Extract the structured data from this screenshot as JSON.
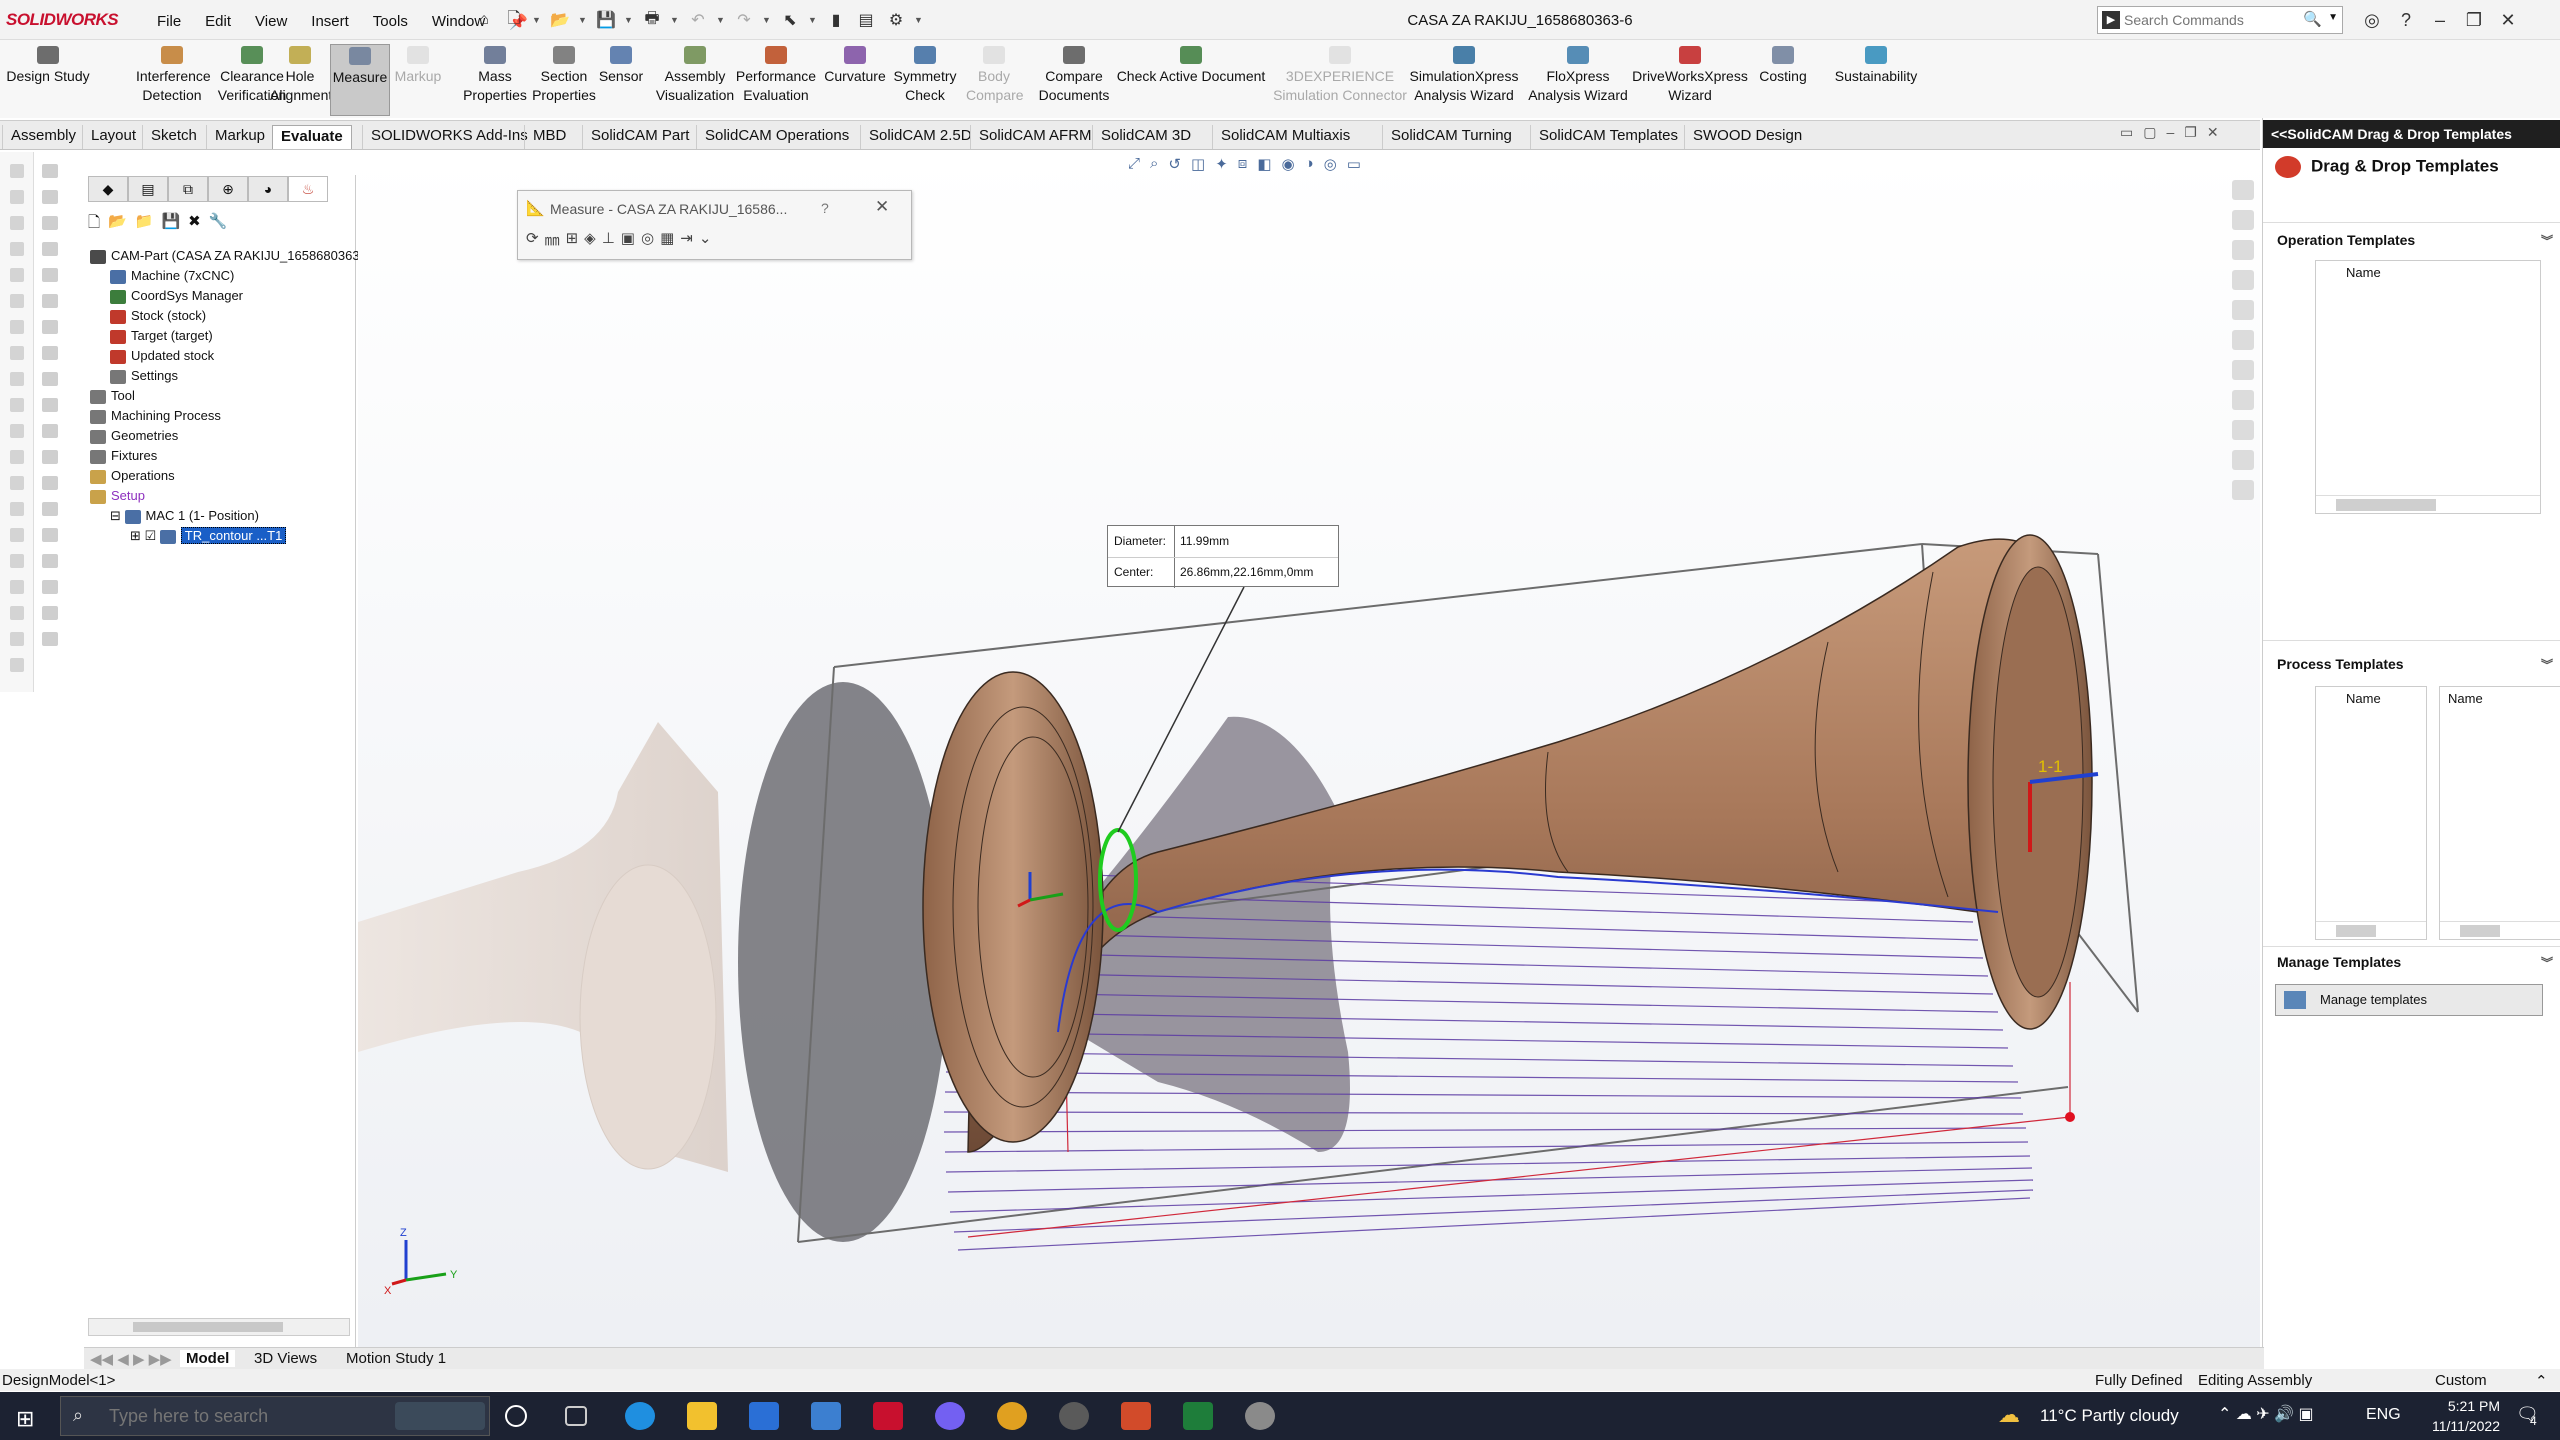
{
  "app": {
    "logo": "SOLIDWORKS",
    "document_title": "CASA ZA RAKIJU_1658680363-6"
  },
  "menus": [
    "File",
    "Edit",
    "View",
    "Insert",
    "Tools",
    "Window"
  ],
  "search": {
    "placeholder": "Search Commands"
  },
  "commands": [
    {
      "label1": "Design Study",
      "label2": "",
      "icon": "design-study-icon",
      "state": "normal"
    },
    {
      "label1": "Interference",
      "label2": "Detection",
      "icon": "interference-icon",
      "state": "normal"
    },
    {
      "label1": "Clearance",
      "label2": "Verification",
      "icon": "clearance-icon",
      "state": "normal"
    },
    {
      "label1": "Hole",
      "label2": "Alignment",
      "icon": "hole-icon",
      "state": "normal"
    },
    {
      "label1": "Measure",
      "label2": "",
      "icon": "measure-icon",
      "state": "active"
    },
    {
      "label1": "Markup",
      "label2": "",
      "icon": "markup-icon",
      "state": "disabled"
    },
    {
      "label1": "Mass",
      "label2": "Properties",
      "icon": "mass-icon",
      "state": "normal"
    },
    {
      "label1": "Section",
      "label2": "Properties",
      "icon": "section-icon",
      "state": "normal"
    },
    {
      "label1": "Sensor",
      "label2": "",
      "icon": "sensor-icon",
      "state": "normal"
    },
    {
      "label1": "Assembly",
      "label2": "Visualization",
      "icon": "assembly-icon",
      "state": "normal"
    },
    {
      "label1": "Performance",
      "label2": "Evaluation",
      "icon": "performance-icon",
      "state": "normal"
    },
    {
      "label1": "Curvature",
      "label2": "",
      "icon": "curvature-icon",
      "state": "normal"
    },
    {
      "label1": "Symmetry",
      "label2": "Check",
      "icon": "symmetry-icon",
      "state": "normal"
    },
    {
      "label1": "Body",
      "label2": "Compare",
      "icon": "body-icon",
      "state": "disabled"
    },
    {
      "label1": "Compare",
      "label2": "Documents",
      "icon": "compare-icon",
      "state": "normal"
    },
    {
      "label1": "Check Active Document",
      "label2": "",
      "icon": "check-icon",
      "state": "normal"
    },
    {
      "label1": "3DEXPERIENCE",
      "label2": "Simulation Connector",
      "icon": "3dx-icon",
      "state": "disabled"
    },
    {
      "label1": "SimulationXpress",
      "label2": "Analysis Wizard",
      "icon": "simxpress-icon",
      "state": "normal"
    },
    {
      "label1": "FloXpress",
      "label2": "Analysis Wizard",
      "icon": "floxpress-icon",
      "state": "normal"
    },
    {
      "label1": "DriveWorksXpress",
      "label2": "Wizard",
      "icon": "driveworks-icon",
      "state": "normal"
    },
    {
      "label1": "Costing",
      "label2": "",
      "icon": "costing-icon",
      "state": "normal"
    },
    {
      "label1": "Sustainability",
      "label2": "",
      "icon": "sustainability-icon",
      "state": "normal"
    }
  ],
  "tabs": [
    "Assembly",
    "Layout",
    "Sketch",
    "Markup",
    "Evaluate",
    "SOLIDWORKS Add-Ins",
    "MBD",
    "SolidCAM Part",
    "SolidCAM Operations",
    "SolidCAM 2.5D",
    "SolidCAM AFRM",
    "SolidCAM 3D",
    "SolidCAM Multiaxis",
    "SolidCAM Turning",
    "SolidCAM Templates",
    "SWOOD Design"
  ],
  "active_tab": "Evaluate",
  "tree": [
    {
      "label": "CAM-Part (CASA ZA RAKIJU_1658680363-6)",
      "indent": 0,
      "icon_color": "#4a4a4a"
    },
    {
      "label": "Machine (7xCNC)",
      "indent": 1,
      "icon_color": "#4a6fa5"
    },
    {
      "label": "CoordSys Manager",
      "indent": 1,
      "icon_color": "#3c7d3c"
    },
    {
      "label": "Stock (stock)",
      "indent": 1,
      "icon_color": "#c0392b"
    },
    {
      "label": "Target (target)",
      "indent": 1,
      "icon_color": "#c0392b"
    },
    {
      "label": "Updated stock",
      "indent": 1,
      "icon_color": "#c0392b"
    },
    {
      "label": "Settings",
      "indent": 1,
      "icon_color": "#777777"
    },
    {
      "label": "Tool",
      "indent": 0,
      "icon_color": "#777777"
    },
    {
      "label": "Machining Process",
      "indent": 0,
      "icon_color": "#777777"
    },
    {
      "label": "Geometries",
      "indent": 0,
      "icon_color": "#777777"
    },
    {
      "label": "Fixtures",
      "indent": 0,
      "icon_color": "#777777"
    },
    {
      "label": "Operations",
      "indent": 0,
      "icon_color": "#c9a24a"
    },
    {
      "label": "Setup",
      "indent": 0,
      "icon_color": "#c9a24a"
    },
    {
      "label": "MAC 1 (1- Position)",
      "indent": 1,
      "icon_color": "#4a6fa5"
    },
    {
      "label": "TR_contour ...T1",
      "indent": 2,
      "icon_color": "#4a6fa5"
    }
  ],
  "measure_dialog": {
    "title": "Measure - CASA ZA RAKIJU_16586...",
    "help": "?",
    "close": "✕"
  },
  "callout": {
    "diameter_label": "Diameter:",
    "diameter_value": "11.99mm",
    "center_label": "Center:",
    "center_value": "26.86mm,22.16mm,0mm"
  },
  "bottom_tabs": [
    "Model",
    "3D Views",
    "Motion Study 1"
  ],
  "active_bottom_tab": "Model",
  "right_panel": {
    "title": "<<SolidCAM Drag & Drop Templates",
    "heading": "Drag & Drop Templates",
    "operation_templates": "Operation Templates",
    "process_templates": "Process Templates",
    "manage_templates": "Manage Templates",
    "name_col": "Name",
    "manage_button": "Manage templates"
  },
  "status": {
    "left": "DesignModel<1>",
    "state": "Fully Defined",
    "mode": "Editing Assembly",
    "units": "Custom"
  },
  "taskbar": {
    "search_placeholder": "Type here to search",
    "weather": "11°C  Partly cloudy",
    "lang": "ENG",
    "time": "5:21 PM",
    "date": "11/11/2022",
    "notifications": "4"
  },
  "triad_labels": {
    "x": "X",
    "y": "Y",
    "z": "Z"
  },
  "csys_label": "1-1"
}
